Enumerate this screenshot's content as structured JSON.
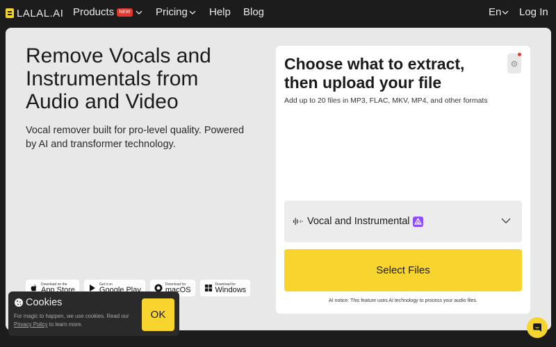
{
  "nav": {
    "logo_text": "LALAL.AI",
    "products_label": "Products",
    "new_badge": "NEW",
    "pricing_label": "Pricing",
    "help_label": "Help",
    "blog_label": "Blog",
    "language_label": "En",
    "login_label": "Log In"
  },
  "hero": {
    "title": "Remove Vocals and Instrumentals from Audio and Video",
    "subtitle": "Vocal remover built for pro-level quality. Powered by AI and transformer technology."
  },
  "stores": [
    {
      "small": "Download on the",
      "big": "App Store",
      "icon": "apple-icon"
    },
    {
      "small": "Get it on",
      "big": "Google Play",
      "icon": "google-play-icon"
    },
    {
      "small": "Download for",
      "big": "macOS",
      "icon": "macos-icon"
    },
    {
      "small": "Download for",
      "big": "Windows",
      "icon": "windows-icon"
    }
  ],
  "upload": {
    "title": "Choose what to extract, then upload your file",
    "subtitle": "Add up to 20 files in MP3, FLAC, MKV, MP4, and other formats",
    "stem_select_value": "Vocal and Instrumental",
    "select_files_label": "Select Files",
    "ai_notice": "AI notice: This feature uses AI technology to process your audio files."
  },
  "cookie": {
    "title": "Cookies",
    "text_before": "For magic to happen, we use cookies. Read our ",
    "link": "Privacy Policy",
    "text_after": " to learn more.",
    "ok_label": "OK"
  },
  "colors": {
    "accent": "#f8d52e",
    "badge_red": "#e5362b",
    "ai_purple": "#8b4dff",
    "background": "#1c1c1c",
    "panel": "#e8e8e8"
  }
}
